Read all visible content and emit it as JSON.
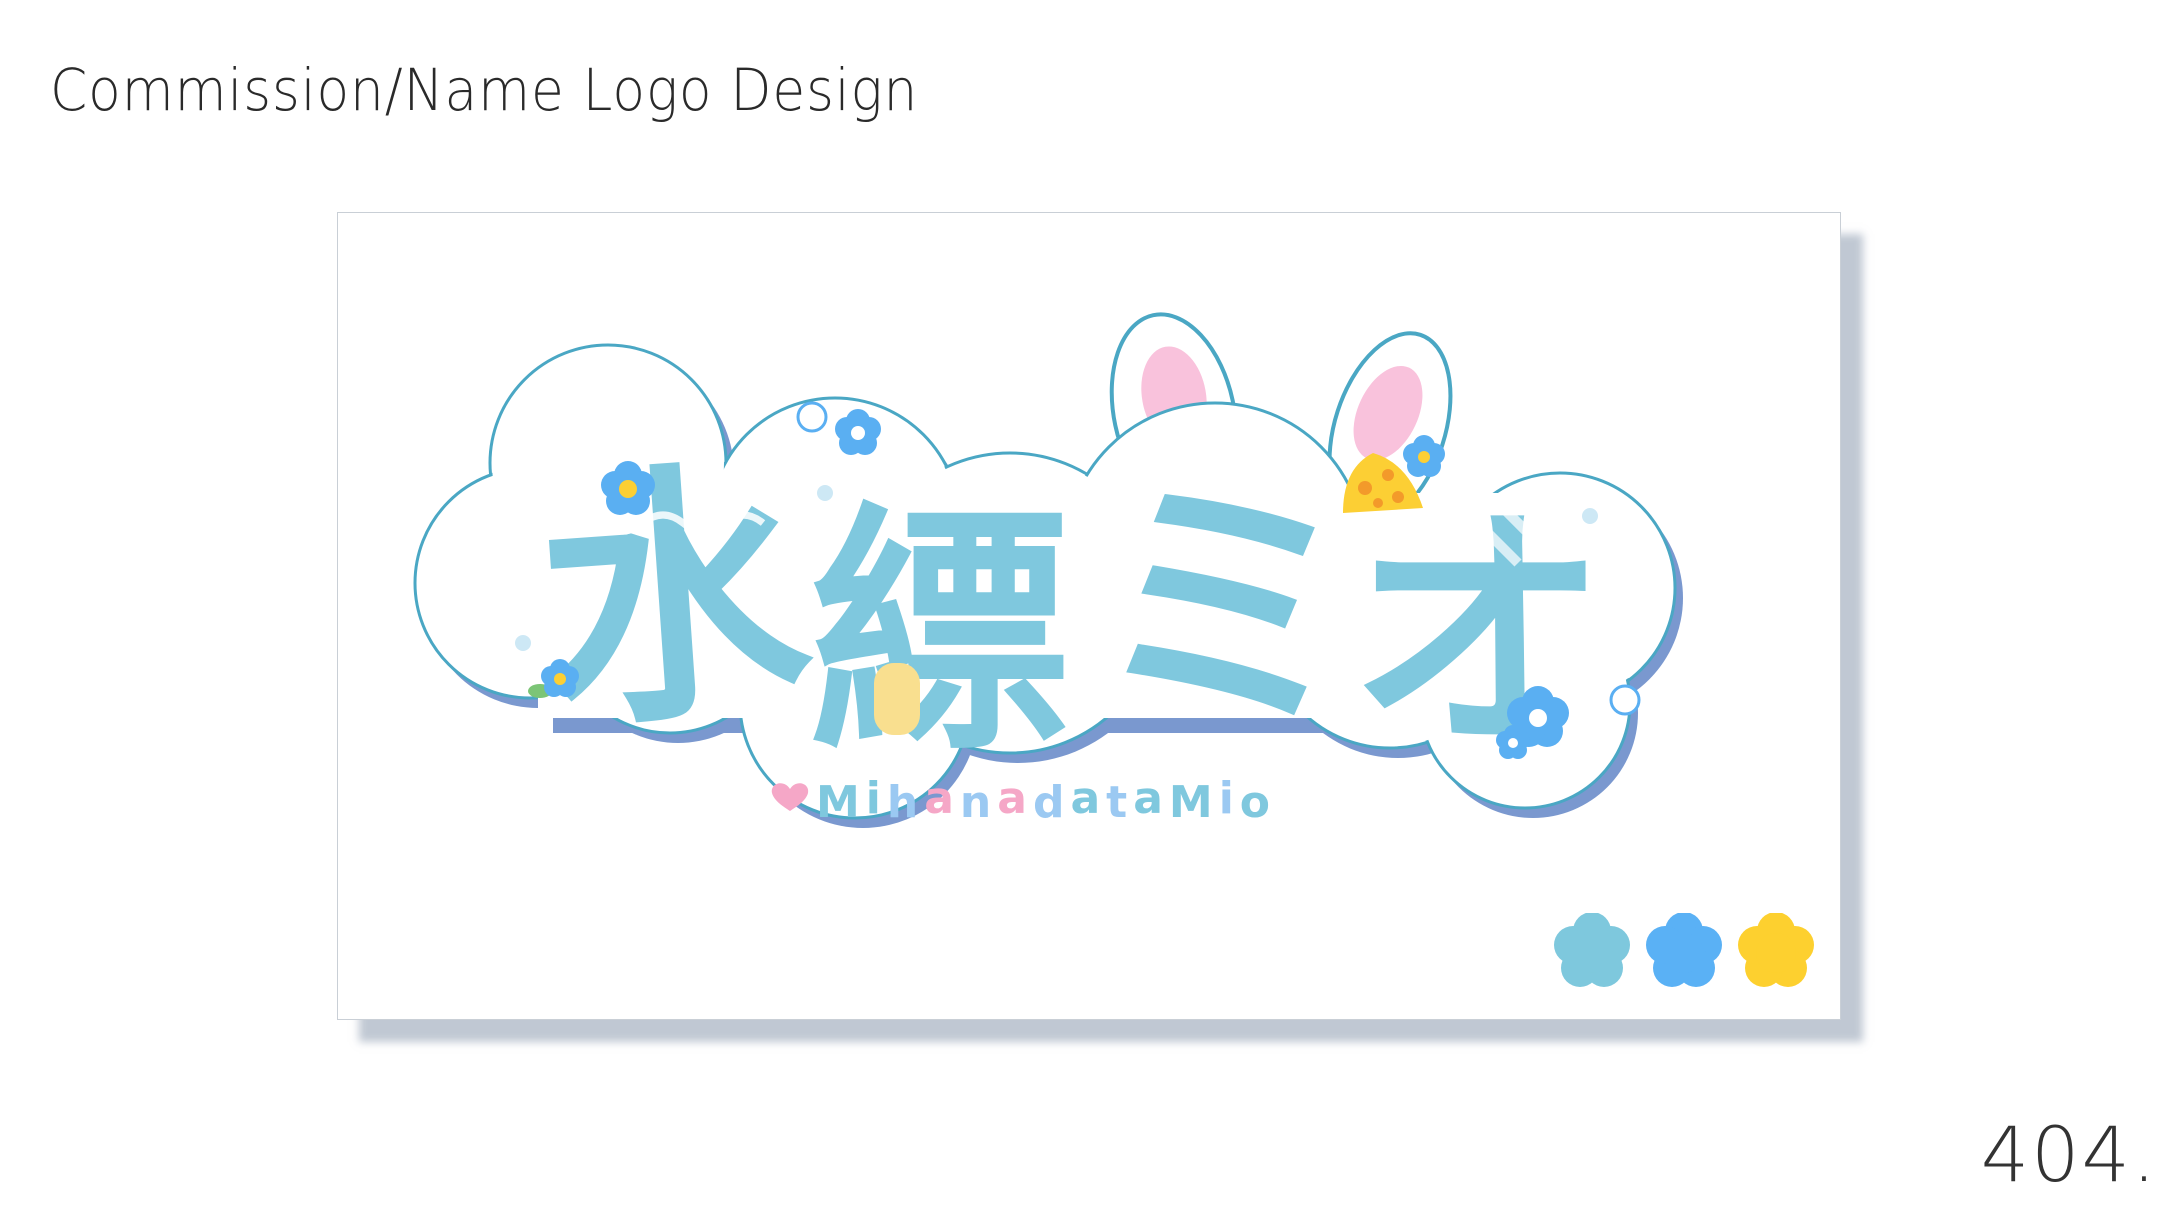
{
  "header": {
    "title": "Commission/Name Logo Design"
  },
  "footer": {
    "page_number": "404."
  },
  "artwork": {
    "logo_kanji": [
      "水",
      "縹",
      "ミ",
      "オ"
    ],
    "logo_subtitle": "MihanadataMio",
    "subtitle_letter_colors": [
      "#7fc8de",
      "#7fc8de",
      "#9bc9f2",
      "#f5a7c7",
      "#9bc9f2",
      "#f5a7c7",
      "#9bc9f2",
      "#7fc8de",
      "#9bc9f2",
      "#7fc8de",
      "#7fc8de",
      "#9bc9f2",
      "#7fc8de"
    ],
    "colors": {
      "main_blue": "#7fc8de",
      "outline_blue": "#4aa7c4",
      "shadow_blue": "#7a98cf",
      "flower_blue": "#5aaff2",
      "flower_yellow": "#fccf34",
      "ear_pink": "#f9c2dc"
    }
  },
  "palette": [
    {
      "name": "light-blue",
      "color": "#7ec8dd"
    },
    {
      "name": "sky-blue",
      "color": "#5ab1f5"
    },
    {
      "name": "yellow",
      "color": "#fdd02f"
    }
  ]
}
